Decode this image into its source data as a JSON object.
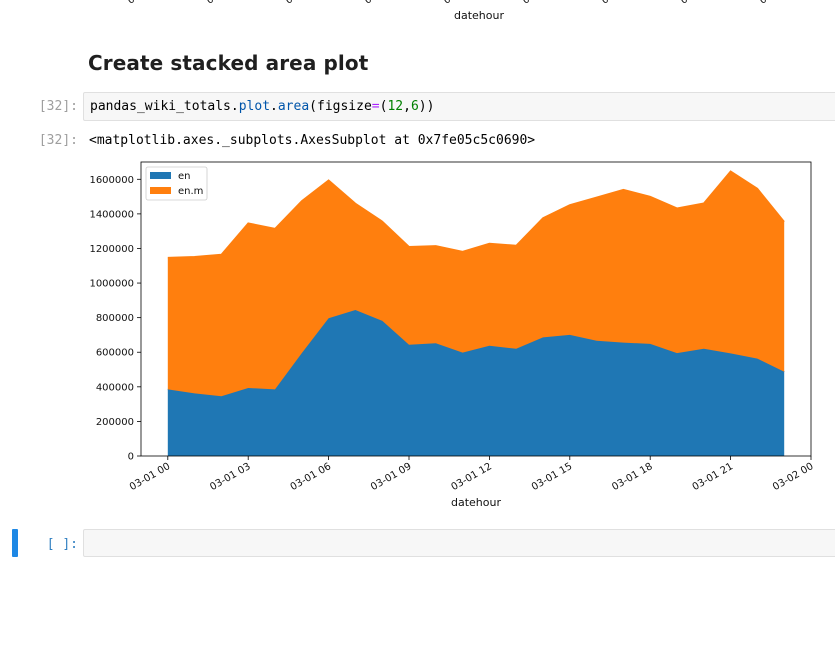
{
  "previous_output": {
    "xlabel": "datehour",
    "tick_fragments": [
      "0",
      "0",
      "0",
      "0",
      "0",
      "0",
      "0",
      "0",
      "0"
    ]
  },
  "heading": "Create stacked area plot",
  "cell_1": {
    "in_prompt": "[32]:",
    "out_prompt": "[32]:",
    "code": {
      "obj": "pandas_wiki_totals",
      "dot1": ".",
      "method1": "plot",
      "dot2": ".",
      "method2": "area",
      "open": "(",
      "kw": "figsize",
      "eq": "=",
      "tuple_open": "(",
      "n1": "12",
      "comma": ",",
      "n2": "6",
      "close": "))"
    },
    "output_text": "<matplotlib.axes._subplots.AxesSubplot at 0x7fe05c5c0690>"
  },
  "cell_2": {
    "in_prompt": "[ ]:",
    "code": ""
  },
  "colors": {
    "en": "#1f77b4",
    "en_m": "#ff7f0e",
    "prompt_active": "#307fc1",
    "active_marker": "#1e88e5"
  },
  "chart_data": {
    "type": "area",
    "stacked": true,
    "title": "",
    "xlabel": "datehour",
    "ylabel": "",
    "x_tick_labels": [
      "03-01 00",
      "03-01 03",
      "03-01 06",
      "03-01 09",
      "03-01 12",
      "03-01 15",
      "03-01 18",
      "03-01 21",
      "03-02 00"
    ],
    "x": [
      "2019-03-01 00:00",
      "2019-03-01 01:00",
      "2019-03-01 02:00",
      "2019-03-01 03:00",
      "2019-03-01 04:00",
      "2019-03-01 05:00",
      "2019-03-01 06:00",
      "2019-03-01 07:00",
      "2019-03-01 08:00",
      "2019-03-01 09:00",
      "2019-03-01 10:00",
      "2019-03-01 11:00",
      "2019-03-01 12:00",
      "2019-03-01 13:00",
      "2019-03-01 14:00",
      "2019-03-01 15:00",
      "2019-03-01 16:00",
      "2019-03-01 17:00",
      "2019-03-01 18:00",
      "2019-03-01 19:00",
      "2019-03-01 20:00",
      "2019-03-01 21:00",
      "2019-03-01 22:00",
      "2019-03-01 23:00"
    ],
    "xlim": [
      "2019-02-28 23:00",
      "2019-03-02 00:00"
    ],
    "ylim": [
      0,
      1700000
    ],
    "y_ticks": [
      0,
      200000,
      400000,
      600000,
      800000,
      1000000,
      1200000,
      1400000,
      1600000
    ],
    "y_tick_labels": [
      "0",
      "200000",
      "400000",
      "600000",
      "800000",
      "1000000",
      "1200000",
      "1400000",
      "1600000"
    ],
    "series": [
      {
        "name": "en",
        "values": [
          385000,
          362000,
          345000,
          393000,
          385000,
          595000,
          797000,
          844000,
          782000,
          643000,
          652000,
          598000,
          637000,
          620000,
          686000,
          700000,
          666000,
          656000,
          648000,
          595000,
          620000,
          593000,
          563000,
          487000
        ]
      },
      {
        "name": "en.m",
        "values": [
          762000,
          790000,
          820000,
          953000,
          930000,
          880000,
          798000,
          616000,
          575000,
          567000,
          563000,
          584000,
          592000,
          597000,
          690000,
          752000,
          830000,
          884000,
          852000,
          838000,
          842000,
          1054000,
          983000,
          868000
        ]
      }
    ],
    "legend": "top-left",
    "grid": false
  }
}
